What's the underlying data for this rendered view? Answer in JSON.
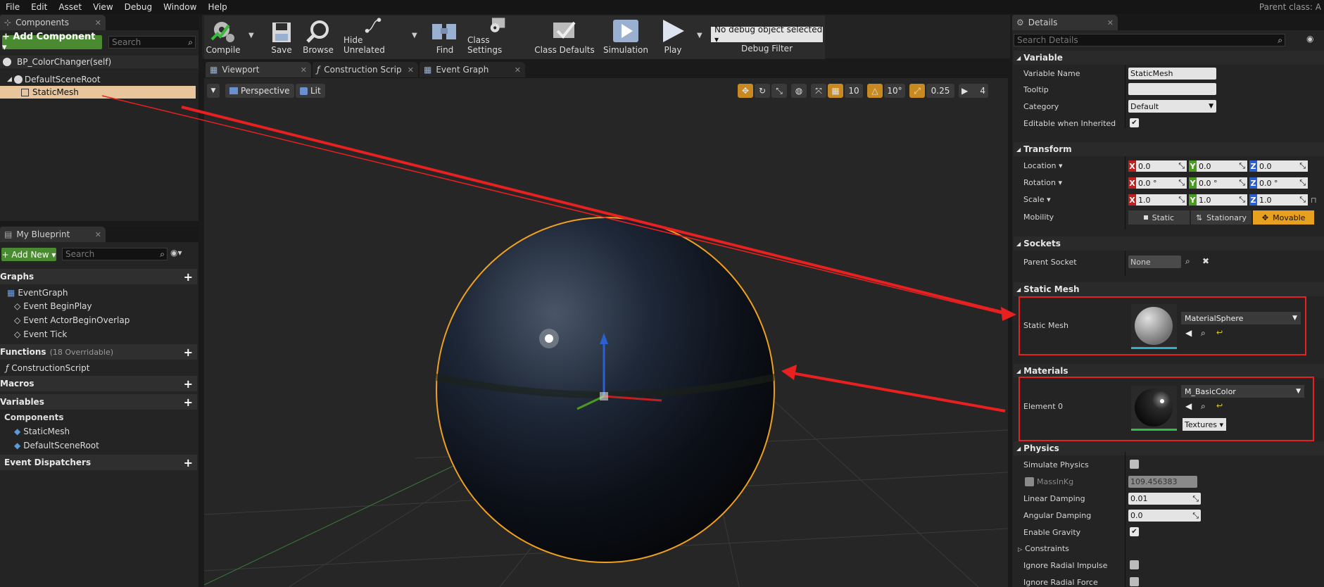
{
  "menu": {
    "items": [
      "File",
      "Edit",
      "Asset",
      "View",
      "Debug",
      "Window",
      "Help"
    ],
    "parent_class": "Parent class: A"
  },
  "components": {
    "tab_label": "Components",
    "add_label": "+ Add Component ▾",
    "search_placeholder": "Search",
    "self_label": "BP_ColorChanger(self)",
    "tree": [
      {
        "label": "DefaultSceneRoot"
      },
      {
        "label": "StaticMesh"
      }
    ]
  },
  "my_blueprint": {
    "tab_label": "My Blueprint",
    "add_new": "+ Add New ▾",
    "search_placeholder": "Search",
    "graphs_label": "Graphs",
    "event_graph": "EventGraph",
    "events": [
      "Event BeginPlay",
      "Event ActorBeginOverlap",
      "Event Tick"
    ],
    "functions_label": "Functions",
    "functions_count": "(18 Overridable)",
    "construction_script": "ConstructionScript",
    "macros_label": "Macros",
    "variables_label": "Variables",
    "components_label": "Components",
    "var_components": [
      "StaticMesh",
      "DefaultSceneRoot"
    ],
    "dispatchers_label": "Event Dispatchers"
  },
  "toolbar": {
    "compile": "Compile",
    "save": "Save",
    "browse": "Browse",
    "hide_unrelated": "Hide Unrelated",
    "find": "Find",
    "class_settings": "Class Settings",
    "class_defaults": "Class Defaults",
    "simulation": "Simulation",
    "play": "Play",
    "debug_select": "No debug object selected ▾",
    "debug_filter": "Debug Filter"
  },
  "editor_tabs": [
    "Viewport",
    "Construction Scrip",
    "Event Graph"
  ],
  "viewport": {
    "perspective": "Perspective",
    "lit": "Lit",
    "grid_snap": "10",
    "rot_snap": "10°",
    "scale_snap": "0.25",
    "cam_speed": "4"
  },
  "details": {
    "tab_label": "Details",
    "search_placeholder": "Search Details",
    "variable": {
      "section": "Variable",
      "name_label": "Variable Name",
      "name_value": "StaticMesh",
      "tooltip_label": "Tooltip",
      "tooltip_value": "",
      "category_label": "Category",
      "category_value": "Default",
      "editable_label": "Editable when Inherited"
    },
    "transform": {
      "section": "Transform",
      "location_label": "Location ▾",
      "rotation_label": "Rotation ▾",
      "scale_label": "Scale ▾",
      "location": [
        "0.0",
        "0.0",
        "0.0"
      ],
      "rotation": [
        "0.0 °",
        "0.0 °",
        "0.0 °"
      ],
      "scale": [
        "1.0",
        "1.0",
        "1.0"
      ],
      "axis_x": "X",
      "axis_y": "Y",
      "axis_z": "Z",
      "mobility_label": "Mobility",
      "mobility_options": [
        "Static",
        "Stationary",
        "Movable"
      ]
    },
    "sockets": {
      "section": "Sockets",
      "parent_label": "Parent Socket",
      "parent_value": "None"
    },
    "static_mesh": {
      "section": "Static Mesh",
      "label": "Static Mesh",
      "value": "MaterialSphere"
    },
    "materials": {
      "section": "Materials",
      "element_label": "Element 0",
      "value": "M_BasicColor",
      "textures": "Textures ▾"
    },
    "physics": {
      "section": "Physics",
      "simulate": "Simulate Physics",
      "mass_label": "MassInKg",
      "mass_value": "109.456383",
      "linear_label": "Linear Damping",
      "linear_value": "0.01",
      "angular_label": "Angular Damping",
      "angular_value": "0.0",
      "gravity_label": "Enable Gravity",
      "constraints_label": "Constraints",
      "ignore_impulse": "Ignore Radial Impulse",
      "ignore_force": "Ignore Radial Force"
    }
  },
  "colors": {
    "accent_green": "#4a8a30",
    "select_orange": "#f0a020",
    "annotation_red": "#e82020",
    "axis_x": "#c02020",
    "axis_y": "#4a9a20",
    "axis_z": "#2a60d0"
  }
}
